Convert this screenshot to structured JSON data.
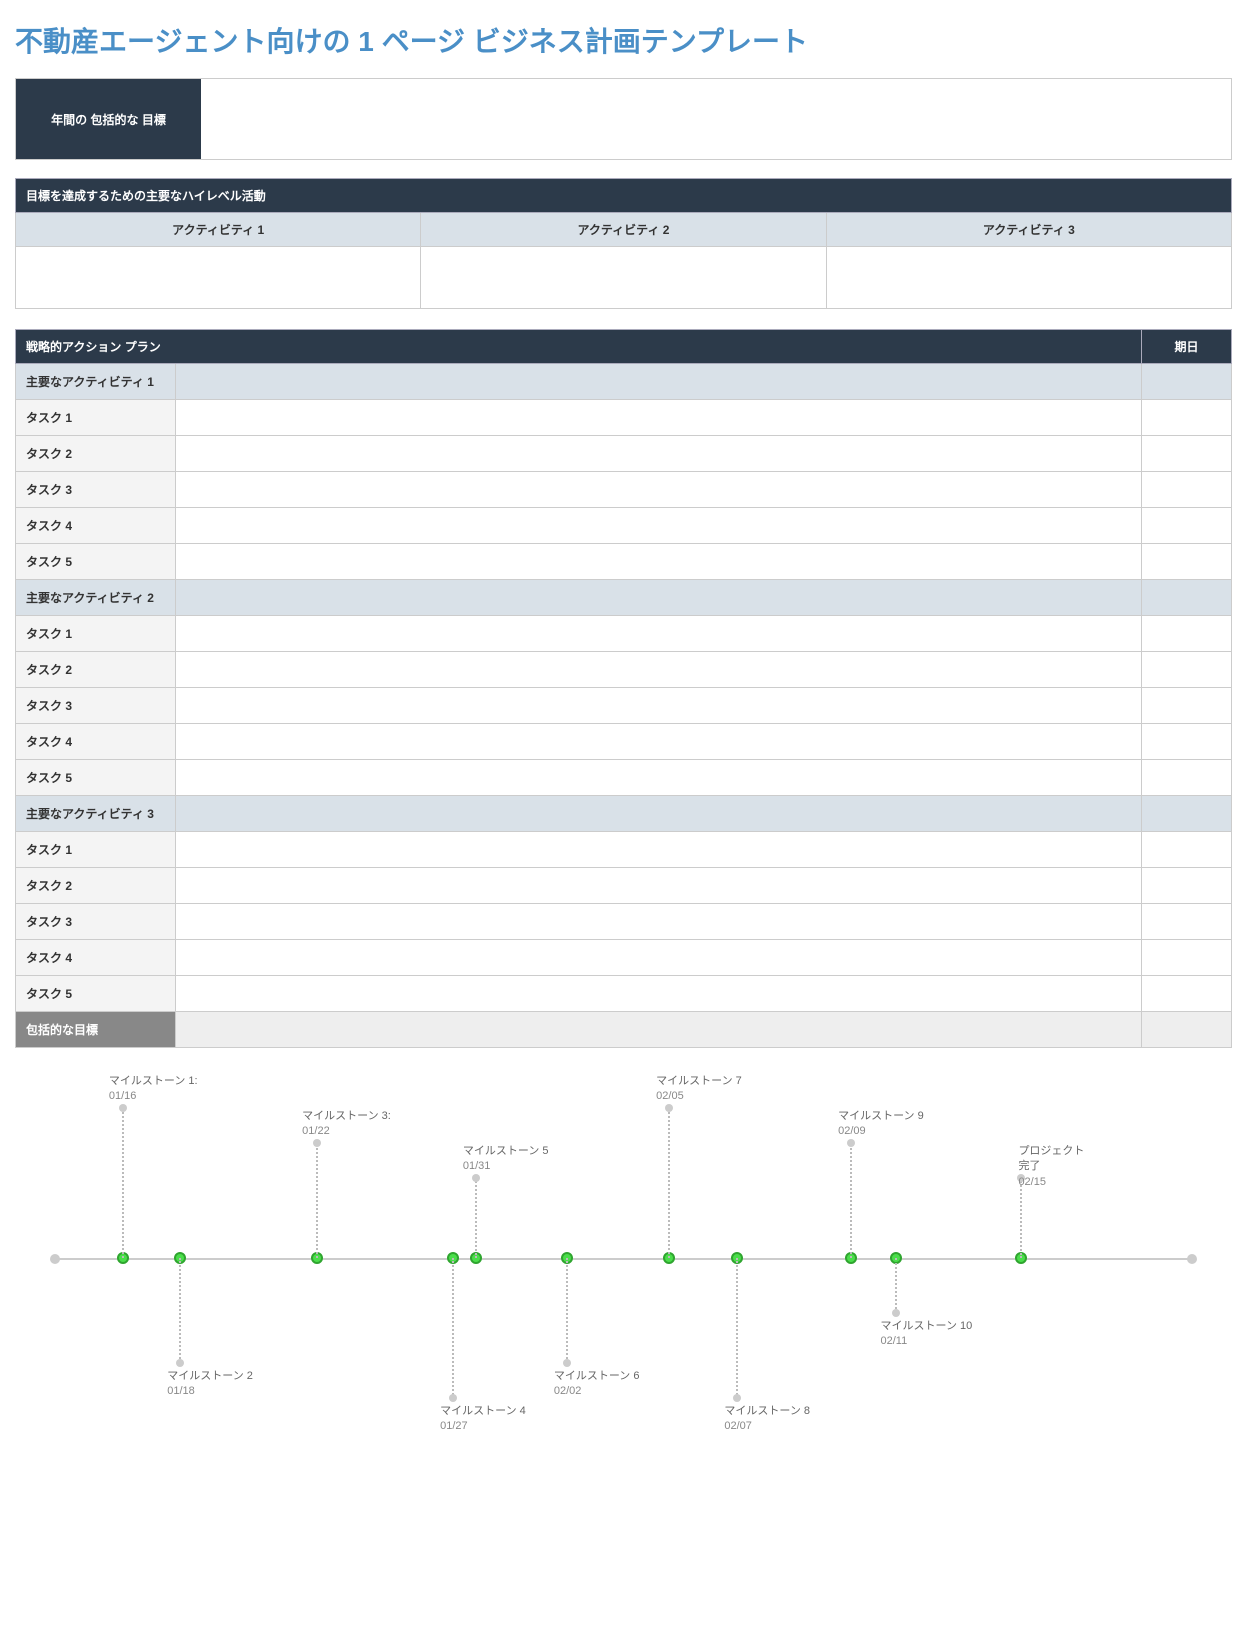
{
  "title": "不動産エージェント向けの 1 ページ ビジネス計画テンプレート",
  "goal": {
    "label": "年間の 包括的な 目標"
  },
  "activities": {
    "header": "目標を達成するための主要なハイレベル活動",
    "cols": [
      "アクティビティ 1",
      "アクティビティ 2",
      "アクティビティ 3"
    ]
  },
  "plan": {
    "header": "戦略的アクション プラン",
    "date_header": "期日",
    "groups": [
      {
        "group_label": "主要なアクティビティ 1",
        "tasks": [
          "タスク 1",
          "タスク 2",
          "タスク 3",
          "タスク 4",
          "タスク 5"
        ]
      },
      {
        "group_label": "主要なアクティビティ 2",
        "tasks": [
          "タスク 1",
          "タスク 2",
          "タスク 3",
          "タスク 4",
          "タスク 5"
        ]
      },
      {
        "group_label": "主要なアクティビティ 3",
        "tasks": [
          "タスク 1",
          "タスク 2",
          "タスク 3",
          "タスク 4",
          "タスク 5"
        ]
      }
    ],
    "footer_label": "包括的な目標"
  },
  "chart_data": {
    "type": "timeline",
    "axis_range": [
      "01/16",
      "02/15"
    ],
    "milestones": [
      {
        "name": "マイルストーン 1:",
        "date": "01/16",
        "pos": 6,
        "side": "top",
        "offset": 150
      },
      {
        "name": "マイルストーン 2",
        "date": "01/18",
        "pos": 11,
        "side": "bottom",
        "offset": 105
      },
      {
        "name": "マイルストーン 3:",
        "date": "01/22",
        "pos": 23,
        "side": "top",
        "offset": 115
      },
      {
        "name": "マイルストーン 4",
        "date": "01/27",
        "pos": 35,
        "side": "bottom",
        "offset": 140
      },
      {
        "name": "マイルストーン 5",
        "date": "01/31",
        "pos": 37,
        "side": "top",
        "offset": 80
      },
      {
        "name": "マイルストーン 6",
        "date": "02/02",
        "pos": 45,
        "side": "bottom",
        "offset": 105
      },
      {
        "name": "マイルストーン 7",
        "date": "02/05",
        "pos": 54,
        "side": "top",
        "offset": 150
      },
      {
        "name": "マイルストーン 8",
        "date": "02/07",
        "pos": 60,
        "side": "bottom",
        "offset": 140
      },
      {
        "name": "マイルストーン 9",
        "date": "02/09",
        "pos": 70,
        "side": "top",
        "offset": 115
      },
      {
        "name": "マイルストーン 10",
        "date": "02/11",
        "pos": 74,
        "side": "bottom",
        "offset": 55
      },
      {
        "name": "プロジェクト\n完了",
        "date": "02/15",
        "pos": 85,
        "side": "top",
        "offset": 80
      }
    ]
  }
}
